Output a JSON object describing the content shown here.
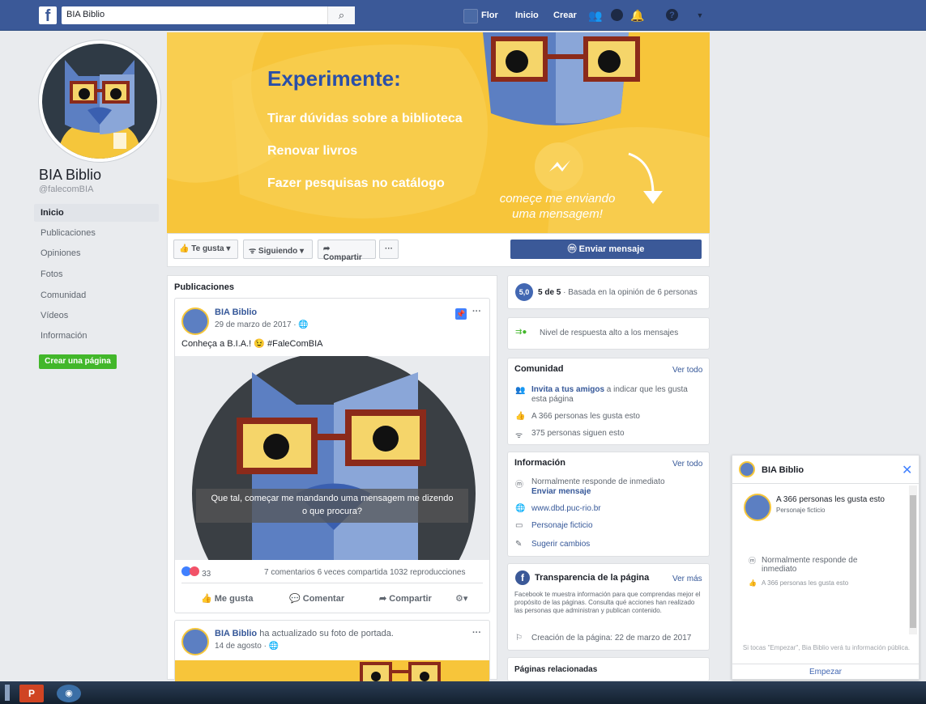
{
  "topbar": {
    "search_value": "BIA Biblio",
    "user_name": "Flor",
    "home": "Inicio",
    "create": "Crear"
  },
  "left": {
    "page_name": "BIA Biblio",
    "handle": "@falecomBIA",
    "nav": [
      "Inicio",
      "Publicaciones",
      "Opiniones",
      "Fotos",
      "Comunidad",
      "Vídeos",
      "Información"
    ],
    "create_page": "Crear una página"
  },
  "cover": {
    "title": "Experimente:",
    "lines": [
      "Tirar dúvidas sobre a biblioteca",
      "Renovar livros",
      "Fazer pesquisas no catálogo"
    ],
    "message_1": "começe me enviando",
    "message_2": "uma mensagem!"
  },
  "actions": {
    "like": "Te gusta",
    "following": "Siguiendo",
    "share": "Compartir",
    "more": "···",
    "send_message": "Enviar mensaje"
  },
  "posts": {
    "header": "Publicaciones",
    "post1": {
      "author": "BIA Biblio",
      "date": "29 de marzo de 2017 ·",
      "text": "Conheça a B.I.A.! 😉 #FaleComBIA",
      "caption_1": "Que tal, começar me mandando uma mensagem me dizendo",
      "caption_2": "o que procura?",
      "reactions": "33",
      "stats": "7 comentarios  6 veces compartida  1032 reproducciones",
      "like": "Me gusta",
      "comment": "Comentar",
      "share": "Compartir"
    },
    "post2": {
      "author": "BIA Biblio",
      "action": " ha actualizado su foto de portada.",
      "date": "14 de agosto ·"
    }
  },
  "right": {
    "rating_badge": "5,0",
    "rating_bold": "5 de 5",
    "rating_text": " · Basada en la opinión de 6 personas",
    "response": "Nivel de respuesta alto a los mensajes",
    "community": {
      "title": "Comunidad",
      "see_all": "Ver todo",
      "invite_link": "Invita a tus amigos",
      "invite_text": " a indicar que les gusta",
      "invite_text_2": "esta página",
      "likes": "A 366 personas les gusta esto",
      "followers": "375 personas siguen esto"
    },
    "info": {
      "title": "Información",
      "see_all": "Ver todo",
      "responds": "Normalmente responde de inmediato",
      "send_msg": "Enviar mensaje",
      "website": "www.dbd.puc-rio.br",
      "category": "Personaje ficticio",
      "suggest": "Sugerir cambios"
    },
    "transparency": {
      "title": "Transparencia de la página",
      "see_more": "Ver más",
      "desc": "Facebook te muestra información para que comprendas mejor el propósito de las páginas. Consulta qué acciones han realizado las personas que administran y publican contenido.",
      "created": "Creación de la página: 22 de marzo de 2017"
    },
    "related": "Páginas relacionadas"
  },
  "chat": {
    "name": "BIA Biblio",
    "likes": "A 366 personas les gusta esto",
    "category": "Personaje ficticio",
    "responds": "Normalmente responde de inmediato",
    "likes2": "A 366 personas les gusta esto",
    "notice": "Si tocas \"Empezar\", Bia Biblio verá tu información pública.",
    "start": "Empezar"
  },
  "colors": {
    "brand": "#3b5998",
    "cover_yellow": "#f7c53a",
    "green": "#42b72a"
  }
}
